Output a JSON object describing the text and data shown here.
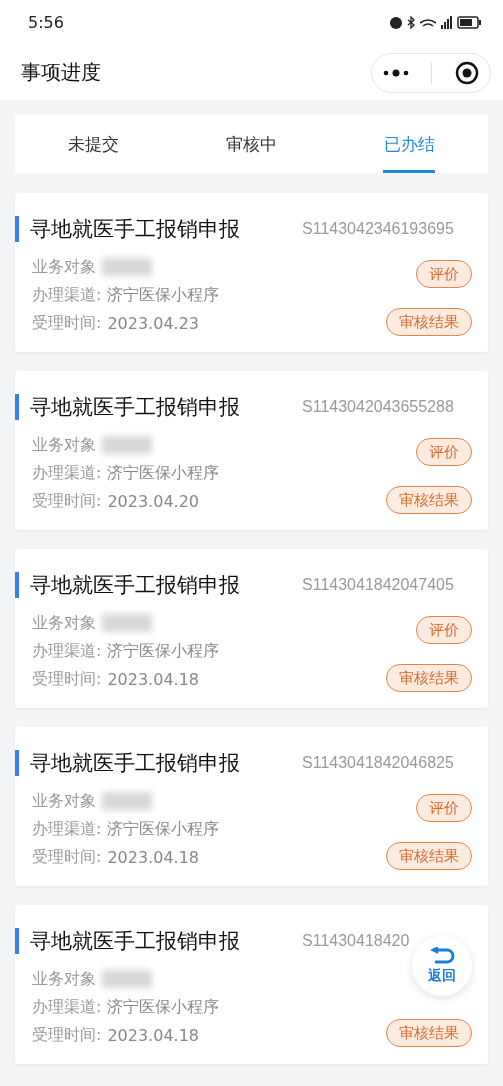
{
  "status_bar": {
    "time": "5:56"
  },
  "header": {
    "title": "事项进度"
  },
  "tabs": [
    {
      "label": "未提交",
      "selected": false
    },
    {
      "label": "审核中",
      "selected": false
    },
    {
      "label": "已办结",
      "selected": true
    }
  ],
  "records": [
    {
      "title": "寻地就医手工报销申报",
      "number": "S1143042346193695",
      "object_label": "业务对象",
      "channel_label": "办理渠道:",
      "channel": "济宁医保小程序",
      "time_label": "受理时间:",
      "time": "2023.04.23",
      "actions": [
        "评价",
        "审核结果"
      ]
    },
    {
      "title": "寻地就医手工报销申报",
      "number": "S1143042043655288",
      "object_label": "业务对象",
      "channel_label": "办理渠道:",
      "channel": "济宁医保小程序",
      "time_label": "受理时间:",
      "time": "2023.04.20",
      "actions": [
        "评价",
        "审核结果"
      ]
    },
    {
      "title": "寻地就医手工报销申报",
      "number": "S1143041842047405",
      "object_label": "业务对象",
      "channel_label": "办理渠道:",
      "channel": "济宁医保小程序",
      "time_label": "受理时间:",
      "time": "2023.04.18",
      "actions": [
        "评价",
        "审核结果"
      ]
    },
    {
      "title": "寻地就医手工报销申报",
      "number": "S1143041842046825",
      "object_label": "业务对象",
      "channel_label": "办理渠道:",
      "channel": "济宁医保小程序",
      "time_label": "受理时间:",
      "time": "2023.04.18",
      "actions": [
        "评价",
        "审核结果"
      ]
    },
    {
      "title": "寻地就医手工报销申报",
      "number": "S11430418420",
      "object_label": "业务对象",
      "channel_label": "办理渠道:",
      "channel": "济宁医保小程序",
      "time_label": "受理时间:",
      "time": "2023.04.18",
      "actions": [
        "审核结果"
      ]
    }
  ],
  "back_button": {
    "label": "返回"
  }
}
